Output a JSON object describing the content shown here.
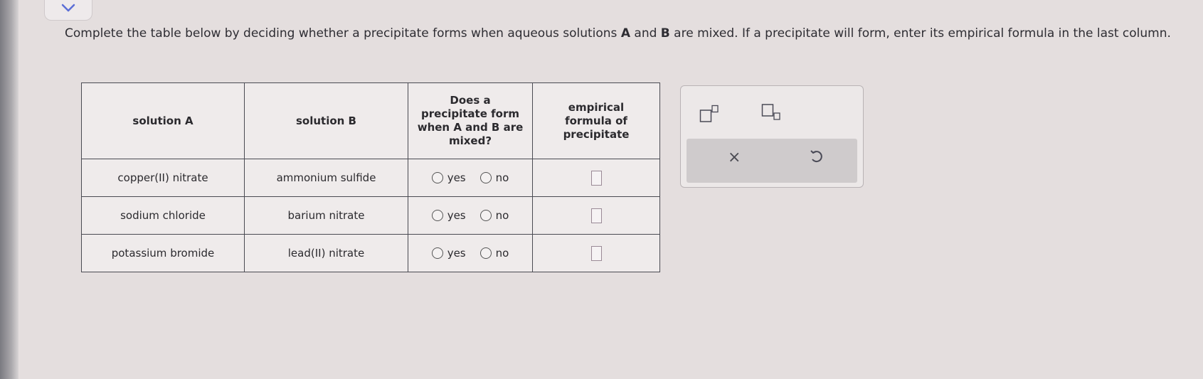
{
  "instructions": {
    "part1": "Complete the table below by deciding whether a precipitate forms when aqueous solutions ",
    "a": "A",
    "part2": " and ",
    "b": "B",
    "part3": " are mixed. If a precipitate will form, enter its empirical formula in the last column."
  },
  "table": {
    "headers": {
      "col1": "solution A",
      "col2": "solution B",
      "col3": "Does a precipitate form when A and B are mixed?",
      "col4": "empirical formula of precipitate"
    },
    "rows": [
      {
        "solution_a": "copper(II) nitrate",
        "solution_b": "ammonium sulfide",
        "yes": "yes",
        "no": "no"
      },
      {
        "solution_a": "sodium chloride",
        "solution_b": "barium nitrate",
        "yes": "yes",
        "no": "no"
      },
      {
        "solution_a": "potassium bromide",
        "solution_b": "lead(II) nitrate",
        "yes": "yes",
        "no": "no"
      }
    ]
  },
  "tools": {
    "superscript": "superscript-icon",
    "subscript": "subscript-icon",
    "clear": "×",
    "undo": "undo-icon"
  },
  "colors": {
    "background": "#e4dede",
    "panel": "#ece8e8",
    "panel_bar": "#cfcbcc",
    "chevron": "#5b6fd6"
  }
}
